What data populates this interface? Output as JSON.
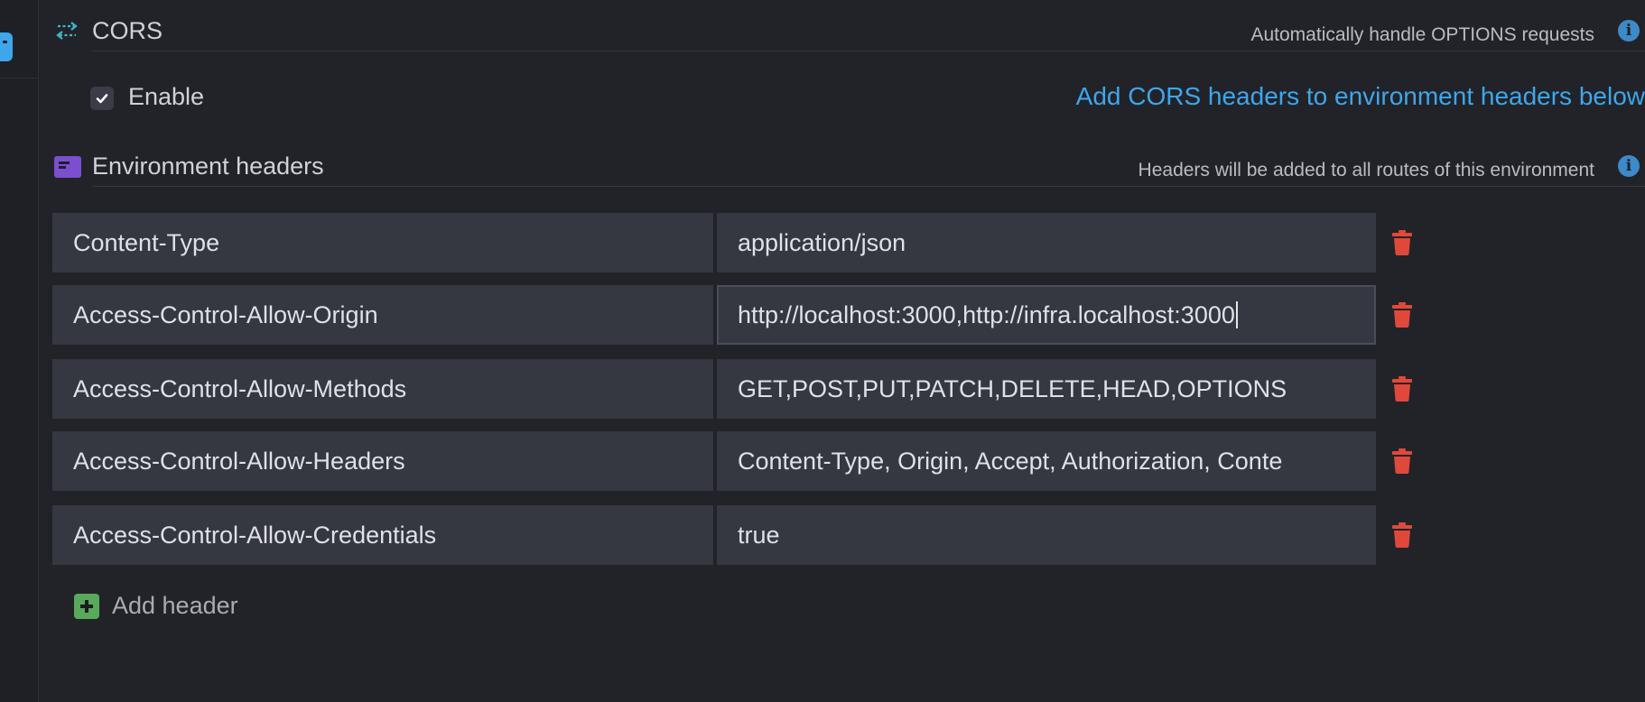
{
  "cors": {
    "title": "CORS",
    "description": "Automatically handle OPTIONS requests",
    "enable_label": "Enable",
    "enabled": true,
    "add_headers_link": "Add CORS headers to environment headers below"
  },
  "env_headers": {
    "title": "Environment headers",
    "description": "Headers will be added to all routes of this environment",
    "rows": [
      {
        "name": "Content-Type",
        "value": "application/json"
      },
      {
        "name": "Access-Control-Allow-Origin",
        "value": "http://localhost:3000,http://infra.localhost:3000"
      },
      {
        "name": "Access-Control-Allow-Methods",
        "value": "GET,POST,PUT,PATCH,DELETE,HEAD,OPTIONS"
      },
      {
        "name": "Access-Control-Allow-Headers",
        "value": "Content-Type, Origin, Accept, Authorization, Conte"
      },
      {
        "name": "Access-Control-Allow-Credentials",
        "value": "true"
      }
    ],
    "add_label": "Add header"
  },
  "icons": {
    "cors": "arrows-left-right-icon",
    "env_headers": "headers-card-icon",
    "info": "info-icon",
    "delete": "trash-icon",
    "add": "plus-square-icon",
    "check": "check-icon"
  },
  "colors": {
    "accent": "#3fa6ea",
    "delete": "#e0493a",
    "add": "#58a95a",
    "env_icon": "#7b4fd0",
    "cors_icon": "#3fb7c8"
  }
}
